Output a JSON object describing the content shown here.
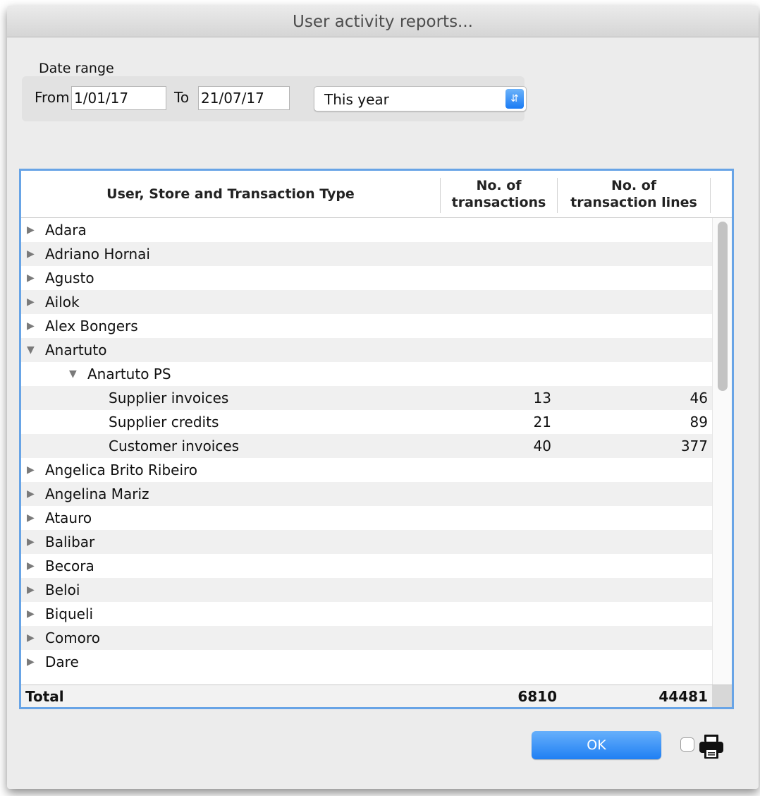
{
  "window": {
    "title": "User activity reports..."
  },
  "date_range": {
    "label": "Date range",
    "from_label": "From",
    "from_value": "1/01/17",
    "to_label": "To",
    "to_value": "21/07/17",
    "preset_selected": "This year"
  },
  "table": {
    "columns": [
      "User, Store and Transaction Type",
      "No. of transactions",
      "No. of transaction lines"
    ],
    "rows": [
      {
        "name": "Adara",
        "level": 0,
        "state": "collapsed",
        "transactions": "",
        "lines": ""
      },
      {
        "name": "Adriano Hornai",
        "level": 0,
        "state": "collapsed",
        "transactions": "",
        "lines": ""
      },
      {
        "name": "Agusto",
        "level": 0,
        "state": "collapsed",
        "transactions": "",
        "lines": ""
      },
      {
        "name": "Ailok",
        "level": 0,
        "state": "collapsed",
        "transactions": "",
        "lines": ""
      },
      {
        "name": "Alex Bongers",
        "level": 0,
        "state": "collapsed",
        "transactions": "",
        "lines": ""
      },
      {
        "name": "Anartuto",
        "level": 0,
        "state": "expanded",
        "transactions": "",
        "lines": ""
      },
      {
        "name": "Anartuto PS",
        "level": 1,
        "state": "expanded",
        "transactions": "",
        "lines": ""
      },
      {
        "name": "Supplier invoices",
        "level": 2,
        "state": "leaf",
        "transactions": "13",
        "lines": "46"
      },
      {
        "name": "Supplier credits",
        "level": 2,
        "state": "leaf",
        "transactions": "21",
        "lines": "89"
      },
      {
        "name": "Customer invoices",
        "level": 2,
        "state": "leaf",
        "transactions": "40",
        "lines": "377"
      },
      {
        "name": "Angelica Brito Ribeiro",
        "level": 0,
        "state": "collapsed",
        "transactions": "",
        "lines": ""
      },
      {
        "name": "Angelina Mariz",
        "level": 0,
        "state": "collapsed",
        "transactions": "",
        "lines": ""
      },
      {
        "name": "Atauro",
        "level": 0,
        "state": "collapsed",
        "transactions": "",
        "lines": ""
      },
      {
        "name": "Balibar",
        "level": 0,
        "state": "collapsed",
        "transactions": "",
        "lines": ""
      },
      {
        "name": "Becora",
        "level": 0,
        "state": "collapsed",
        "transactions": "",
        "lines": ""
      },
      {
        "name": "Beloi",
        "level": 0,
        "state": "collapsed",
        "transactions": "",
        "lines": ""
      },
      {
        "name": "Biqueli",
        "level": 0,
        "state": "collapsed",
        "transactions": "",
        "lines": ""
      },
      {
        "name": "Comoro",
        "level": 0,
        "state": "collapsed",
        "transactions": "",
        "lines": ""
      },
      {
        "name": "Dare",
        "level": 0,
        "state": "collapsed",
        "transactions": "",
        "lines": ""
      }
    ],
    "total": {
      "label": "Total",
      "transactions": "6810",
      "lines": "44481"
    }
  },
  "footer": {
    "ok_label": "OK"
  },
  "icons": {
    "collapsed": "disclosure-triangle-right-icon",
    "expanded": "disclosure-triangle-down-icon",
    "print": "printer-icon",
    "popup": "chevron-up-down-icon"
  },
  "colors": {
    "accent": "#1f7ff3",
    "table_focus_border": "#68a4e6"
  }
}
